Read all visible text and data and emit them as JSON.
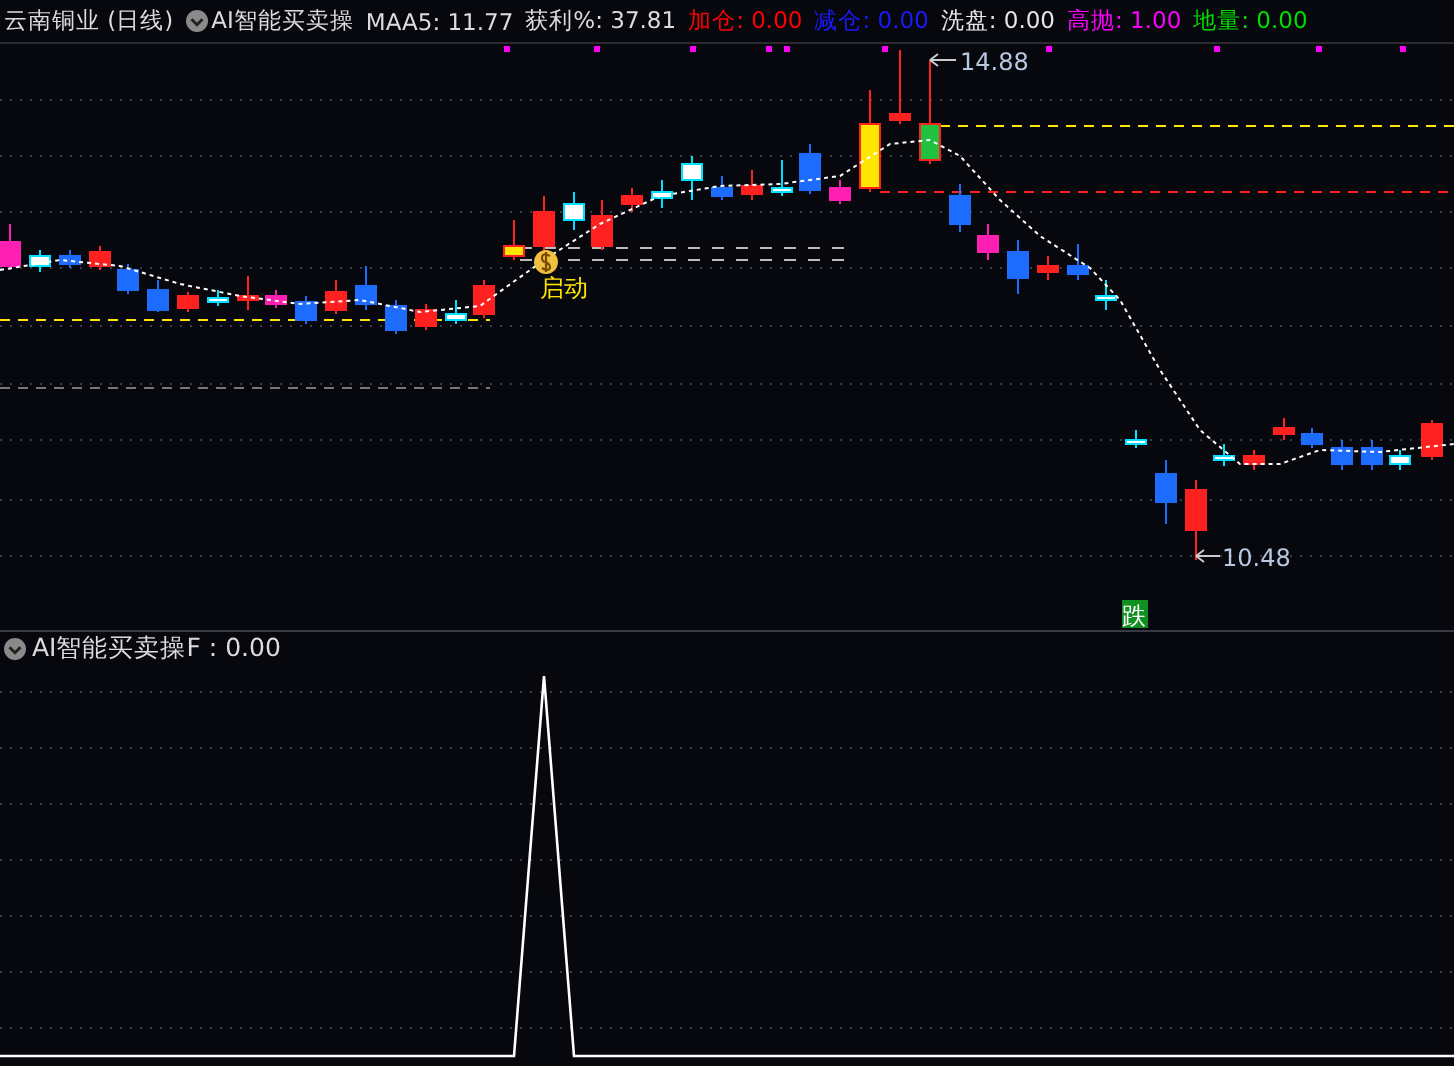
{
  "price_panel": {
    "title": "云南铜业 (日线)",
    "indicator": "AI智能买卖操",
    "values": [
      {
        "label": "MAA5:",
        "value": "11.77",
        "color": "#dcdcdc"
      },
      {
        "label": "获利%:",
        "value": "37.81",
        "color": "#dcdcdc"
      },
      {
        "label": "加仓:",
        "value": "0.00",
        "color": "#ff0000"
      },
      {
        "label": "减仓:",
        "value": "0.00",
        "color": "#1a1aff"
      },
      {
        "label": "洗盘:",
        "value": "0.00",
        "color": "#e6e6e6"
      },
      {
        "label": "高抛:",
        "value": "1.00",
        "color": "#ff00ff"
      },
      {
        "label": "地量:",
        "value": "0.00",
        "color": "#00dd00"
      }
    ],
    "high_marker": "14.88",
    "low_marker": "10.48",
    "start_signal": "启动",
    "fall_signal": "跌"
  },
  "indicator_panel": {
    "title": "AI智能买卖操F : 0.00"
  }
}
